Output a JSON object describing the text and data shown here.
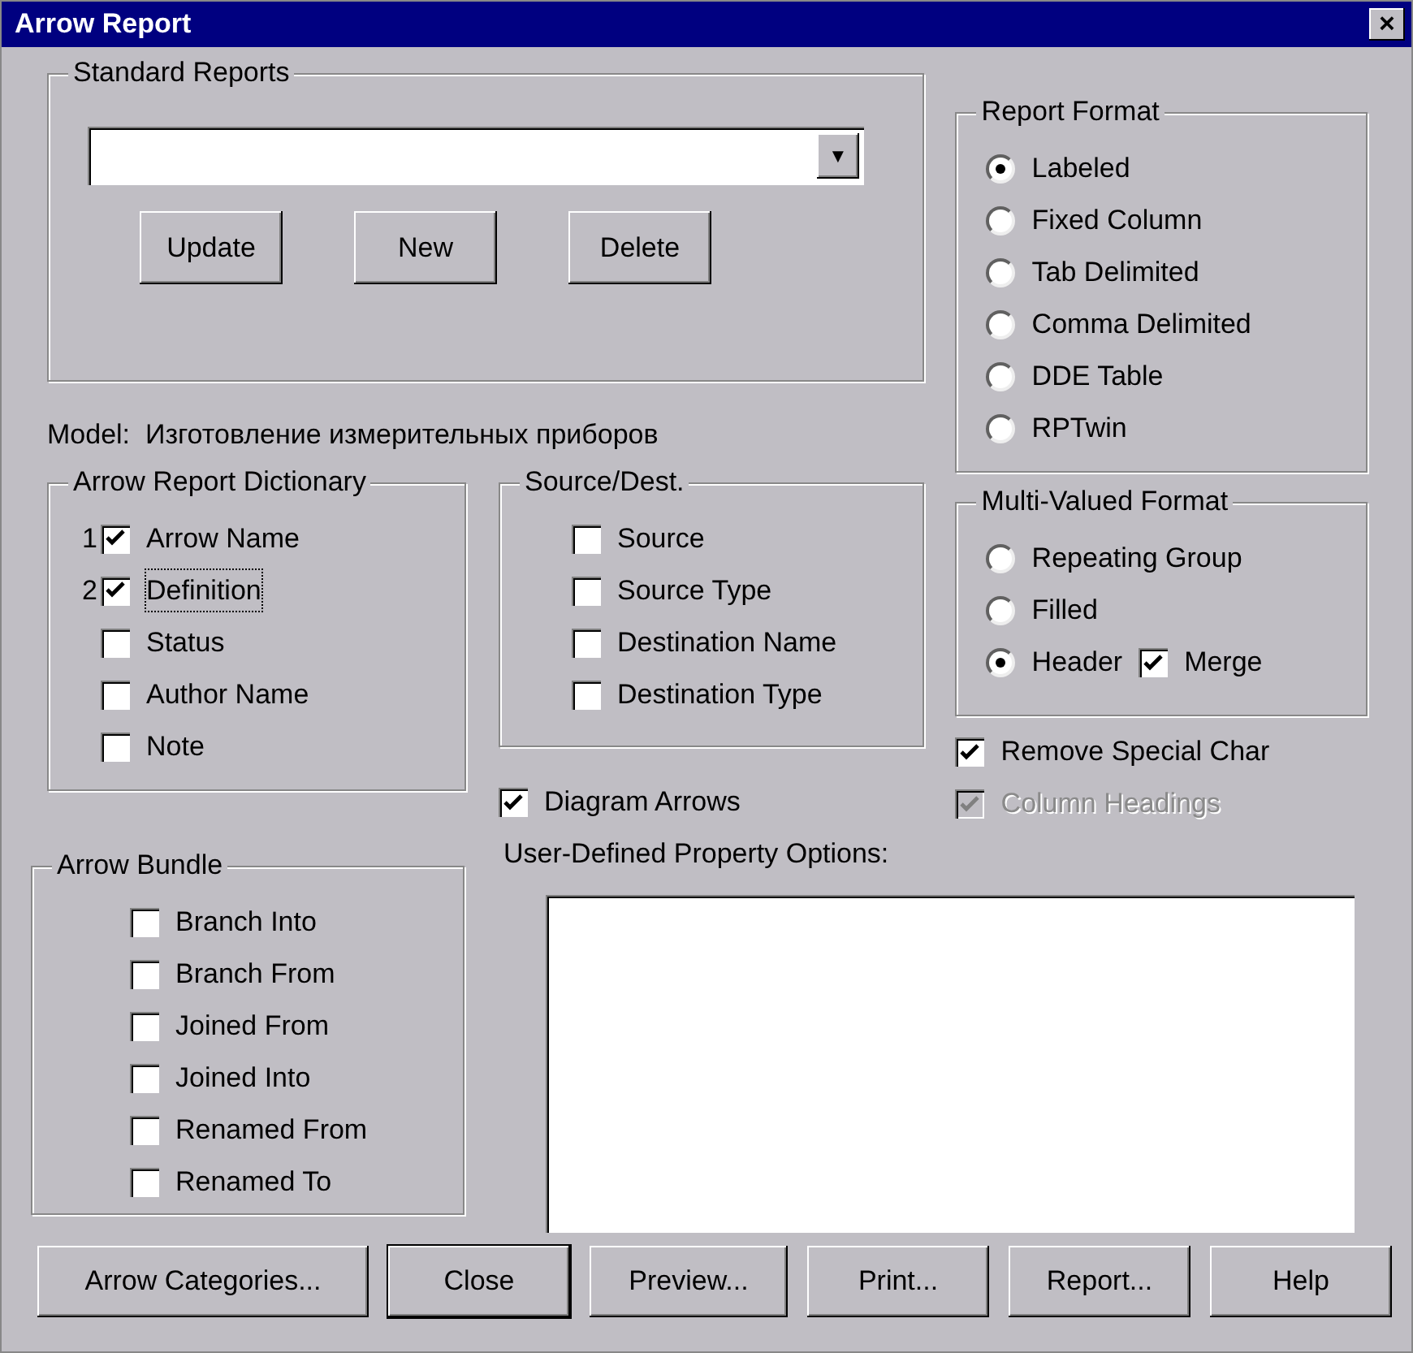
{
  "window": {
    "title": "Arrow Report",
    "close": "×"
  },
  "standard_reports": {
    "title": "Standard Reports",
    "dropdown_arrow": "▼",
    "buttons": [
      "Update",
      "New",
      "Delete"
    ]
  },
  "model": {
    "label": "Model:",
    "value": "Изготовление измерительных приборов"
  },
  "dictionary": {
    "title": "Arrow Report Dictionary",
    "items": [
      {
        "order": "1",
        "label": "Arrow Name",
        "checked": true,
        "focused": false
      },
      {
        "order": "2",
        "label": "Definition",
        "checked": true,
        "focused": true
      },
      {
        "label": "Status",
        "checked": false,
        "focused": false
      },
      {
        "label": "Author Name",
        "checked": false,
        "focused": false
      },
      {
        "label": "Note",
        "checked": false,
        "focused": false
      }
    ]
  },
  "source_dest": {
    "title": "Source/Dest.",
    "items": [
      {
        "label": "Source",
        "checked": false
      },
      {
        "label": "Source Type",
        "checked": false
      },
      {
        "label": "Destination Name",
        "checked": false
      },
      {
        "label": "Destination Type",
        "checked": false
      }
    ]
  },
  "diagram_arrows": {
    "label": "Diagram Arrows",
    "checked": true
  },
  "report_format": {
    "title": "Report Format",
    "options": [
      {
        "label": "Labeled",
        "selected": true
      },
      {
        "label": "Fixed Column",
        "selected": false
      },
      {
        "label": "Tab Delimited",
        "selected": false
      },
      {
        "label": "Comma Delimited",
        "selected": false
      },
      {
        "label": "DDE Table",
        "selected": false
      },
      {
        "label": "RPTwin",
        "selected": false
      }
    ]
  },
  "multi_valued_format": {
    "title": "Multi-Valued Format",
    "options": [
      {
        "label": "Repeating Group",
        "selected": false
      },
      {
        "label": "Filled",
        "selected": false
      },
      {
        "label": "Header",
        "selected": true
      }
    ],
    "merge": {
      "label": "Merge",
      "checked": true
    }
  },
  "options": [
    {
      "label": "Remove Special Char",
      "checked": true,
      "disabled": false
    },
    {
      "label": "Column Headings",
      "checked": true,
      "disabled": true
    }
  ],
  "arrow_bundle": {
    "title": "Arrow Bundle",
    "items": [
      {
        "label": "Branch Into",
        "checked": false
      },
      {
        "label": "Branch From",
        "checked": false
      },
      {
        "label": "Joined From",
        "checked": false
      },
      {
        "label": "Joined Into",
        "checked": false
      },
      {
        "label": "Renamed From",
        "checked": false
      },
      {
        "label": "Renamed To",
        "checked": false
      }
    ]
  },
  "user_defined": {
    "label": "User-Defined Property Options:"
  },
  "buttons": [
    {
      "label": "Arrow Categories...",
      "default": false
    },
    {
      "label": "Close",
      "default": true
    },
    {
      "label": "Preview...",
      "default": false
    },
    {
      "label": "Print...",
      "default": false
    },
    {
      "label": "Report...",
      "default": false
    },
    {
      "label": "Help",
      "default": false
    }
  ]
}
